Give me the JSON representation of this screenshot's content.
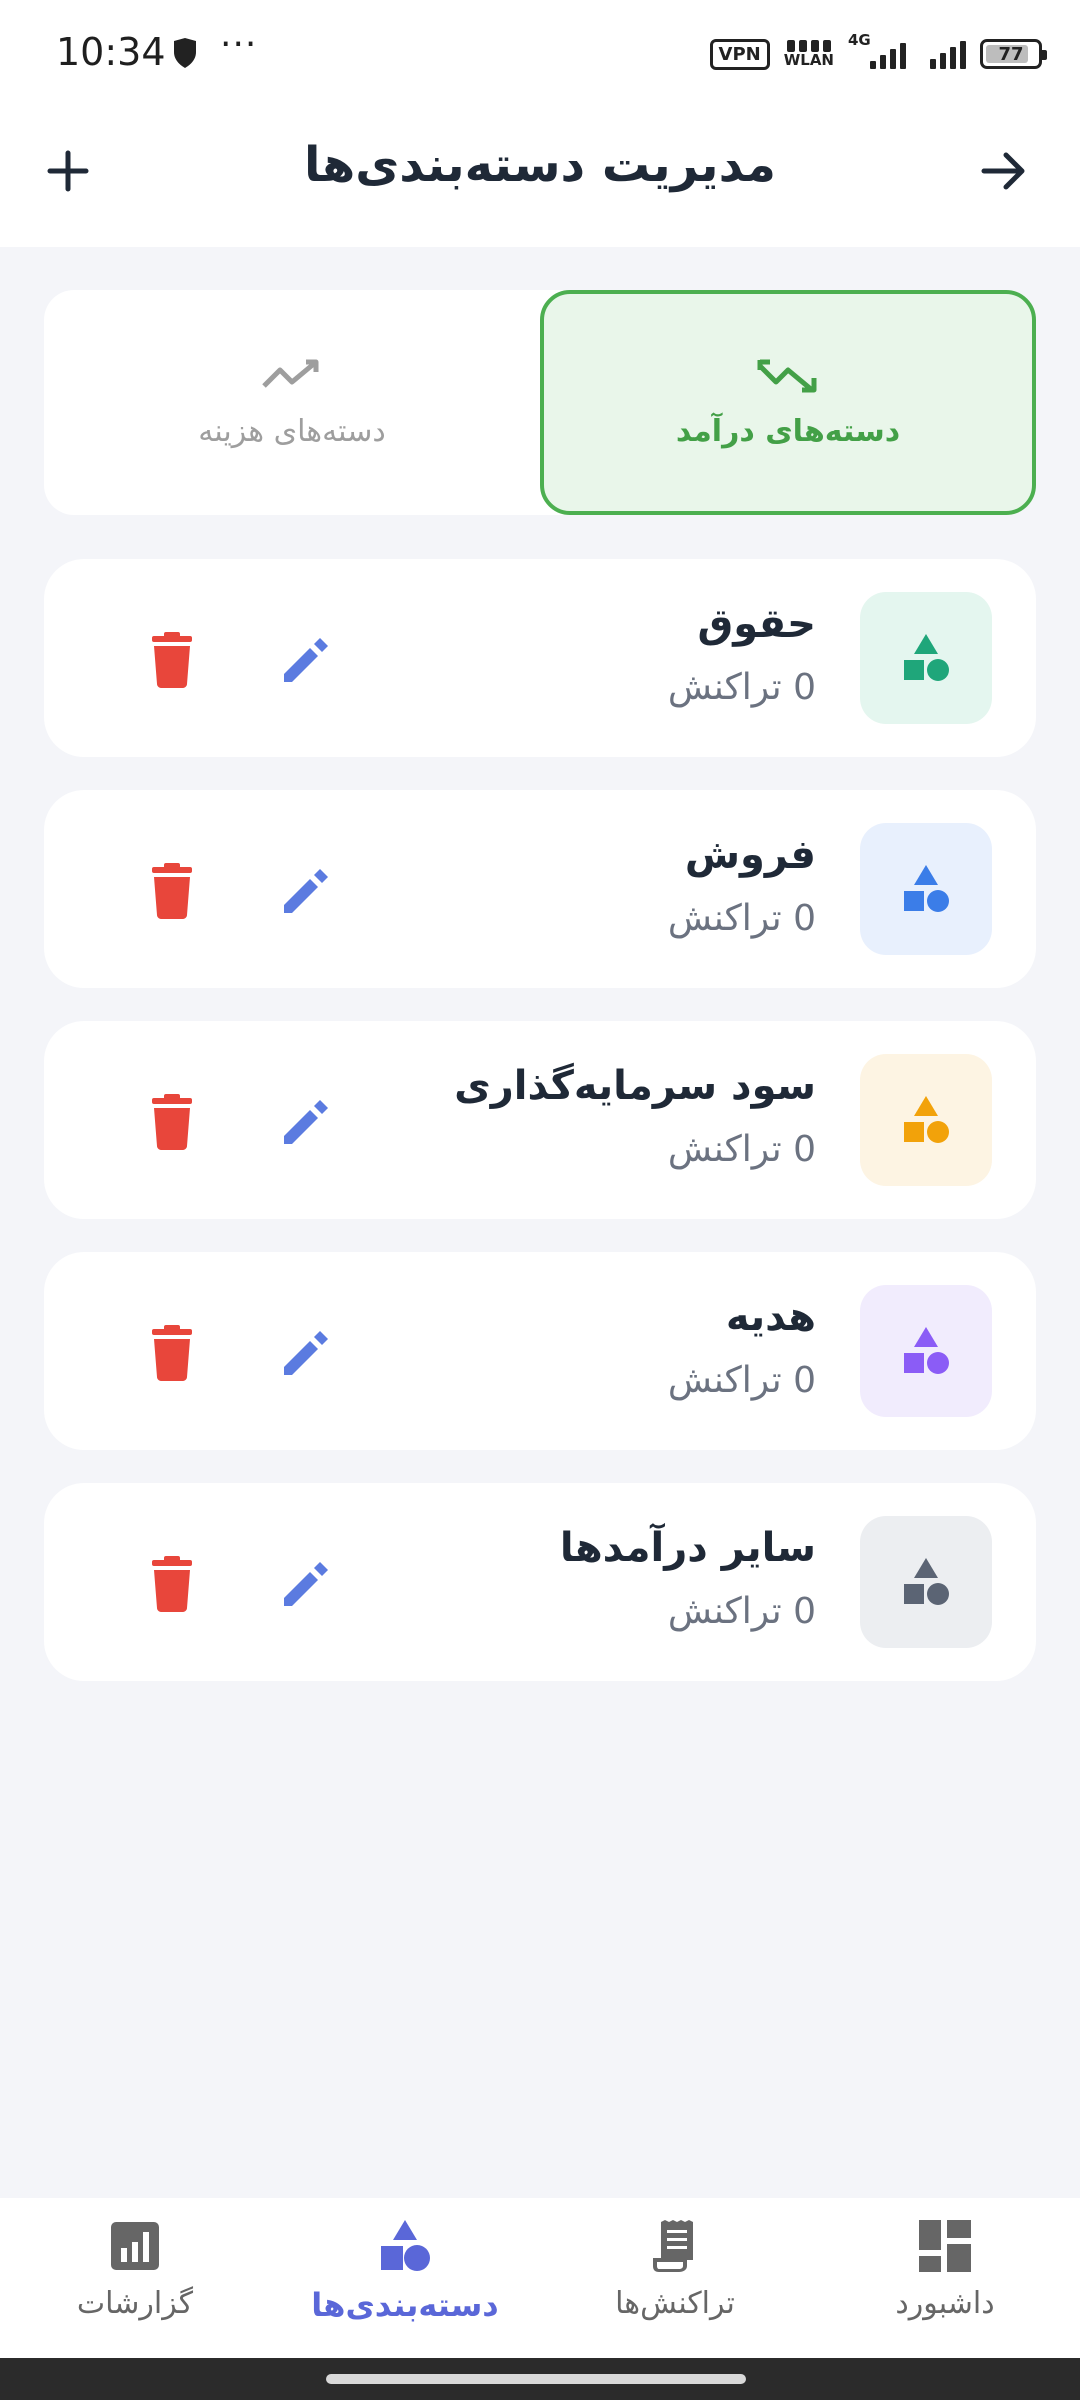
{
  "status_bar": {
    "time": "10:34",
    "more": "···",
    "vpn": "VPN",
    "wlan": "WLAN",
    "network": "4G",
    "battery": "77",
    "icons": [
      "shield-icon",
      "vpn-icon",
      "wlan-icon",
      "signal-icon",
      "battery-icon"
    ]
  },
  "app_bar": {
    "title": "مدیریت دسته‌بندی‌ها",
    "back_icon": "arrow-forward-icon",
    "add_icon": "plus-icon"
  },
  "tabs": {
    "income": {
      "label": "دسته‌های درآمد",
      "icon": "trending-up-icon",
      "selected": true,
      "color": "#4caf50"
    },
    "expense": {
      "label": "دسته‌های هزینه",
      "icon": "trending-down-icon",
      "selected": false,
      "color": "#9e9e9e"
    }
  },
  "categories": [
    {
      "name": "حقوق",
      "count": "0 تراکنش",
      "color": "#1fa67a",
      "bg": "#e4f6ef",
      "icon": "category-icon"
    },
    {
      "name": "فروش",
      "count": "0 تراکنش",
      "color": "#3b7de8",
      "bg": "#e8f0fd",
      "icon": "category-icon"
    },
    {
      "name": "سود سرمایه‌گذاری",
      "count": "0 تراکنش",
      "color": "#f2a20a",
      "bg": "#fdf4e3",
      "icon": "category-icon"
    },
    {
      "name": "هدیه",
      "count": "0 تراکنش",
      "color": "#8b5cf6",
      "bg": "#f1ecfd",
      "icon": "category-icon"
    },
    {
      "name": "سایر درآمدها",
      "count": "0 تراکنش",
      "color": "#5b6474",
      "bg": "#eceef1",
      "icon": "category-icon"
    }
  ],
  "actions": {
    "edit_color": "#5b7be0",
    "delete_color": "#e8463b"
  },
  "bottom_nav": [
    {
      "label": "داشبورد",
      "icon": "dashboard-icon",
      "active": false
    },
    {
      "label": "تراکنش‌ها",
      "icon": "receipt-icon",
      "active": false
    },
    {
      "label": "دسته‌بندی‌ها",
      "icon": "category-icon",
      "active": true
    },
    {
      "label": "گزارشات",
      "icon": "reports-icon",
      "active": false
    }
  ]
}
